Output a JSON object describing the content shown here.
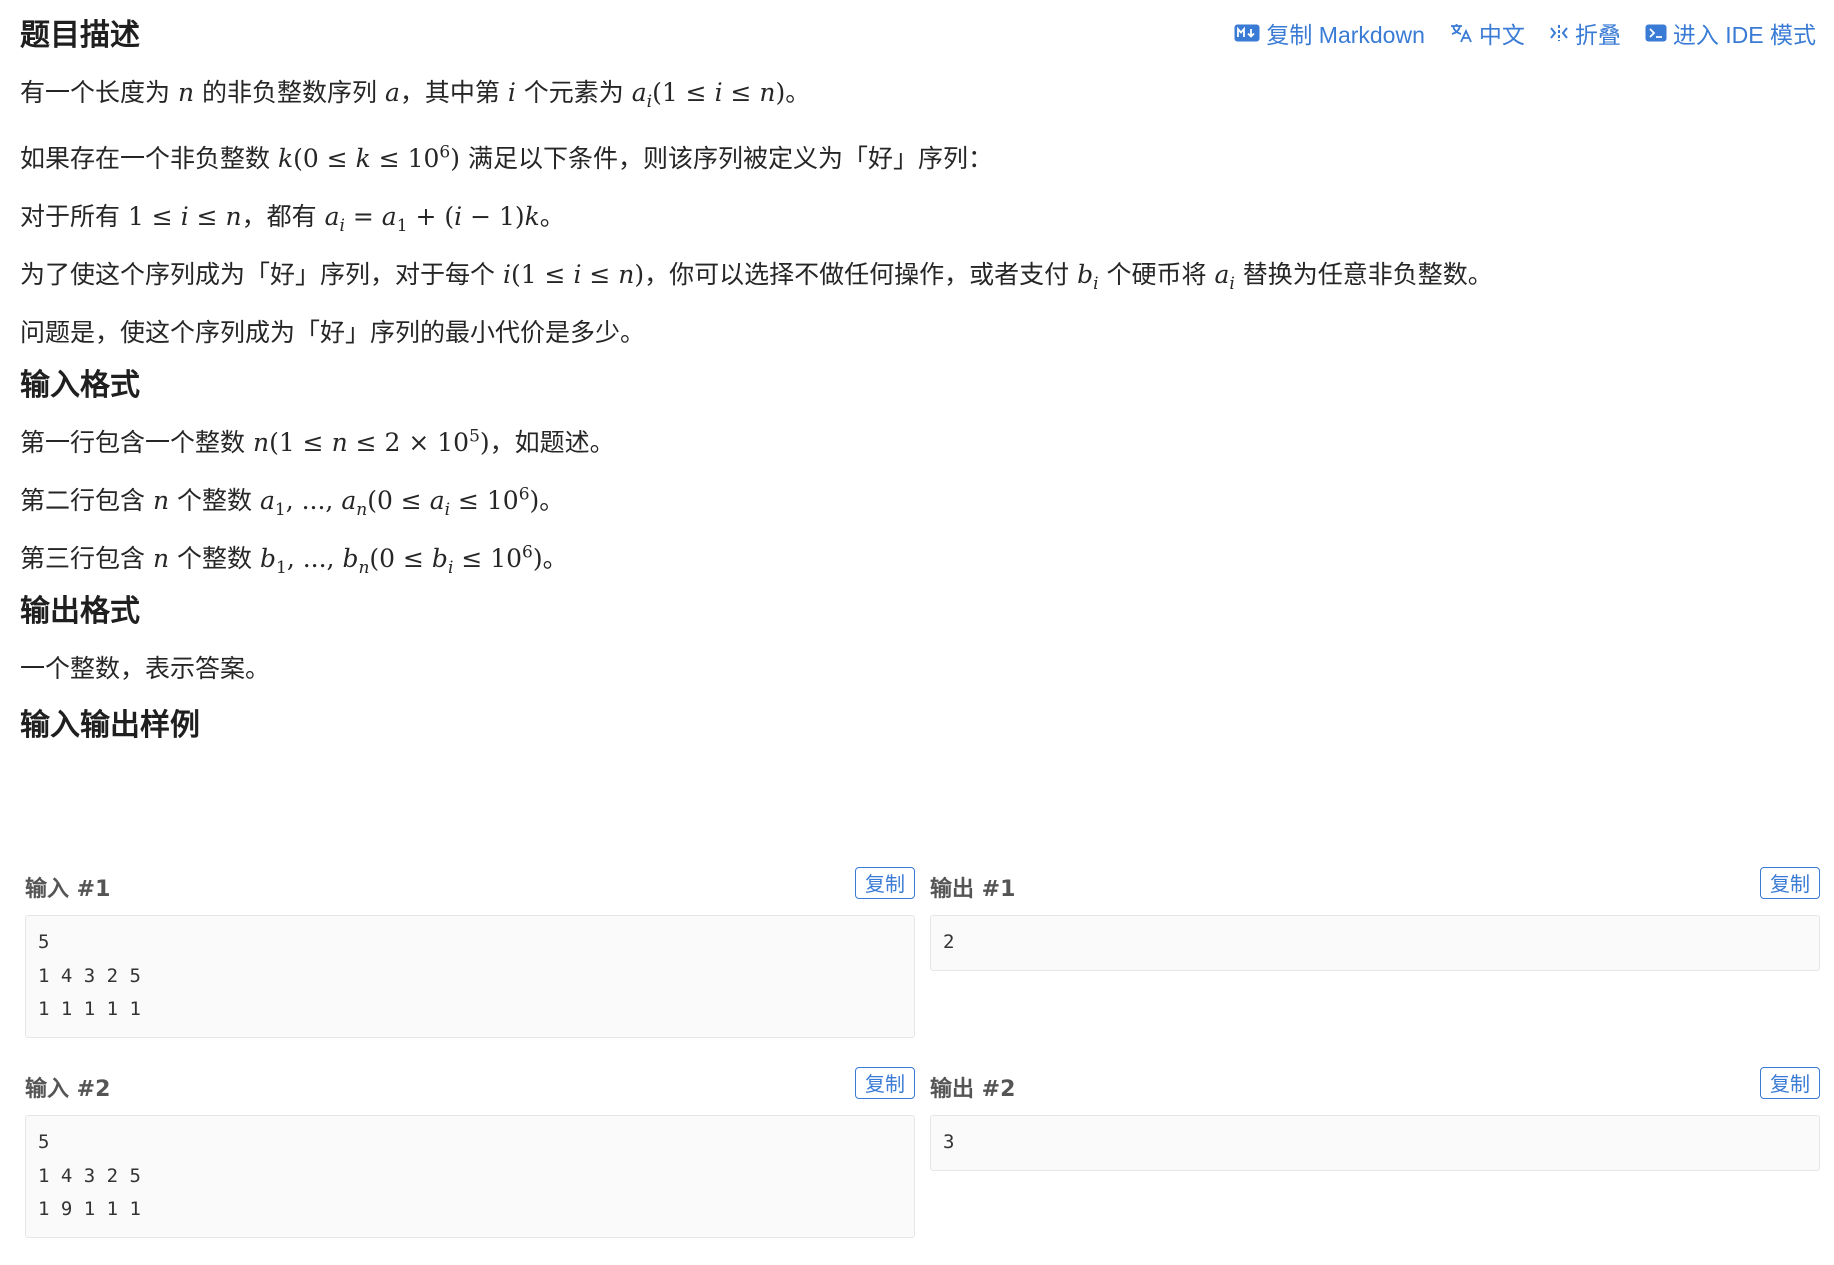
{
  "toolbar": {
    "copy_markdown": "复制 Markdown",
    "language": "中文",
    "collapse": "折叠",
    "ide_mode": "进入 IDE 模式",
    "accent": "#3a7bd5"
  },
  "description": {
    "heading": "题目描述"
  },
  "input_format": {
    "heading": "输入格式"
  },
  "output_format": {
    "heading": "输出格式",
    "text": "一个整数，表示答案。"
  },
  "samples": {
    "heading": "输入输出样例",
    "copy_label": "复制",
    "items": [
      {
        "input_title": "输入 #1",
        "input": "5\n1 4 3 2 5\n1 1 1 1 1",
        "output_title": "输出 #1",
        "output": "2"
      },
      {
        "input_title": "输入 #2",
        "input": "5\n1 4 3 2 5\n1 9 1 1 1",
        "output_title": "输出 #2",
        "output": "3"
      }
    ]
  }
}
